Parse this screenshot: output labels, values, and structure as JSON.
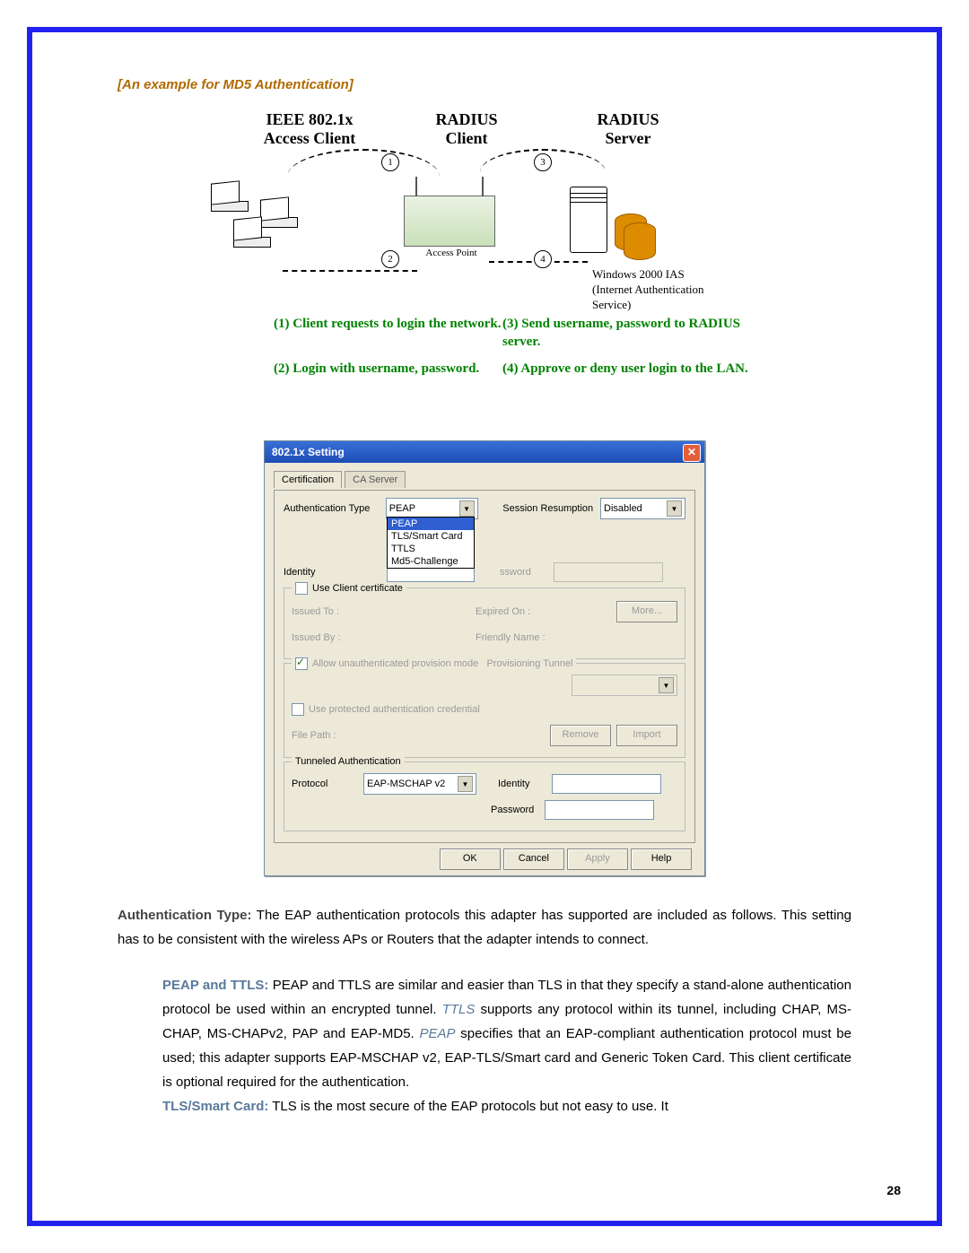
{
  "heading": "[An example for MD5 Authentication]",
  "diagram": {
    "titles": {
      "client": "IEEE 802.1x\nAccess Client",
      "radius_client": "RADIUS\nClient",
      "radius_server": "RADIUS\nServer"
    },
    "ap_label": "Access Point",
    "server_label": "Windows 2000 IAS\n(Internet Authentication\nService)",
    "steps": {
      "s1": "(1) Client requests to login the network.",
      "s2": "(2) Login with username, password.",
      "s3": "(3) Send username, password to RADIUS server.",
      "s4": "(4) Approve or deny user login to the LAN."
    },
    "nums": [
      "1",
      "2",
      "3",
      "4"
    ]
  },
  "dialog": {
    "title": "802.1x Setting",
    "tabs": {
      "t1": "Certification",
      "t2": "CA Server"
    },
    "labels": {
      "auth_type": "Authentication Type",
      "session_resumption": "Session Resumption",
      "identity": "Identity",
      "password_masked": "ssword",
      "use_client_cert": "Use Client certificate",
      "issued_to": "Issued To :",
      "expired_on": "Expired On :",
      "issued_by": "Issued By :",
      "friendly_name": "Friendly Name :",
      "more": "More...",
      "allow_prov": "Allow unauthenticated provision mode",
      "prov_tunnel": "Provisioning Tunnel",
      "use_protected": "Use protected authentication credential",
      "file_path": "File Path :",
      "remove": "Remove",
      "import": "Import",
      "tunneled": "Tunneled Authentication",
      "protocol": "Protocol",
      "identity2": "Identity",
      "password2": "Password"
    },
    "values": {
      "auth_type": "PEAP",
      "session_resumption": "Disabled",
      "protocol": "EAP-MSCHAP v2"
    },
    "dropdown_opts": [
      "PEAP",
      "TLS/Smart Card",
      "TTLS",
      "Md5-Challenge"
    ],
    "buttons": {
      "ok": "OK",
      "cancel": "Cancel",
      "apply": "Apply",
      "help": "Help"
    }
  },
  "para1": {
    "lead": "Authentication Type:",
    "text": " The EAP authentication protocols this adapter has supported are included as follows. This setting has to be consistent with the wireless APs or Routers that the adapter intends to connect."
  },
  "para2": {
    "peap_title": "PEAP and TTLS:",
    "peap_1": " PEAP and TTLS are similar and easier than TLS in that they specify a stand-alone authentication protocol be used within an encrypted tunnel. ",
    "ttls_il": "TTLS",
    "peap_2": " supports any protocol within its tunnel, including CHAP, MS-CHAP, MS-CHAPv2, PAP and EAP-MD5. ",
    "peap_il": "PEAP",
    "peap_3": " specifies that an EAP-compliant authentication protocol must be used; this adapter supports EAP-MSCHAP v2, EAP-TLS/Smart card and Generic Token Card. This client certificate is optional required for the authentication.",
    "tls_title": "TLS/Smart Card:",
    "tls_1": " TLS is the most secure of the EAP protocols but not easy to use. It"
  },
  "page_number": "28"
}
